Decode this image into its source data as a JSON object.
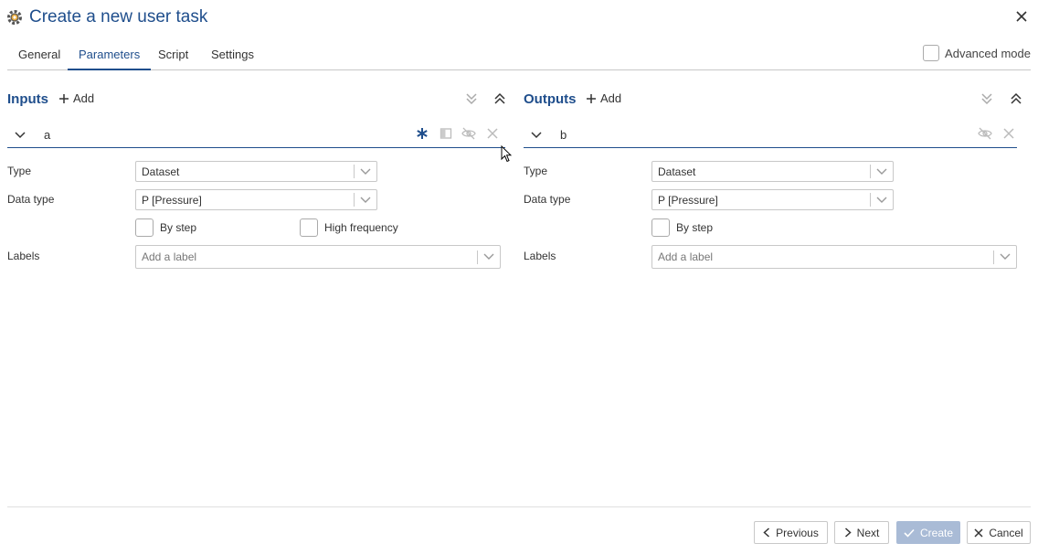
{
  "window": {
    "title": "Create a new user task"
  },
  "tabs": [
    {
      "label": "General"
    },
    {
      "label": "Parameters",
      "active": true
    },
    {
      "label": "Script"
    },
    {
      "label": "Settings"
    }
  ],
  "advanced_mode": {
    "label": "Advanced mode",
    "checked": false
  },
  "inputs": {
    "title": "Inputs",
    "add_label": "Add",
    "param": {
      "name": "a",
      "type_label": "Type",
      "type_value": "Dataset",
      "datatype_label": "Data type",
      "datatype_value": "P [Pressure]",
      "by_step_label": "By step",
      "high_freq_label": "High frequency",
      "labels_label": "Labels",
      "labels_placeholder": "Add a label"
    }
  },
  "outputs": {
    "title": "Outputs",
    "add_label": "Add",
    "param": {
      "name": "b",
      "type_label": "Type",
      "type_value": "Dataset",
      "datatype_label": "Data type",
      "datatype_value": "P [Pressure]",
      "by_step_label": "By step",
      "labels_label": "Labels",
      "labels_placeholder": "Add a label"
    }
  },
  "footer": {
    "previous": "Previous",
    "next": "Next",
    "create": "Create",
    "cancel": "Cancel"
  },
  "colors": {
    "accent": "#1f4e8c",
    "disabled_button": "#a9bbd6"
  }
}
